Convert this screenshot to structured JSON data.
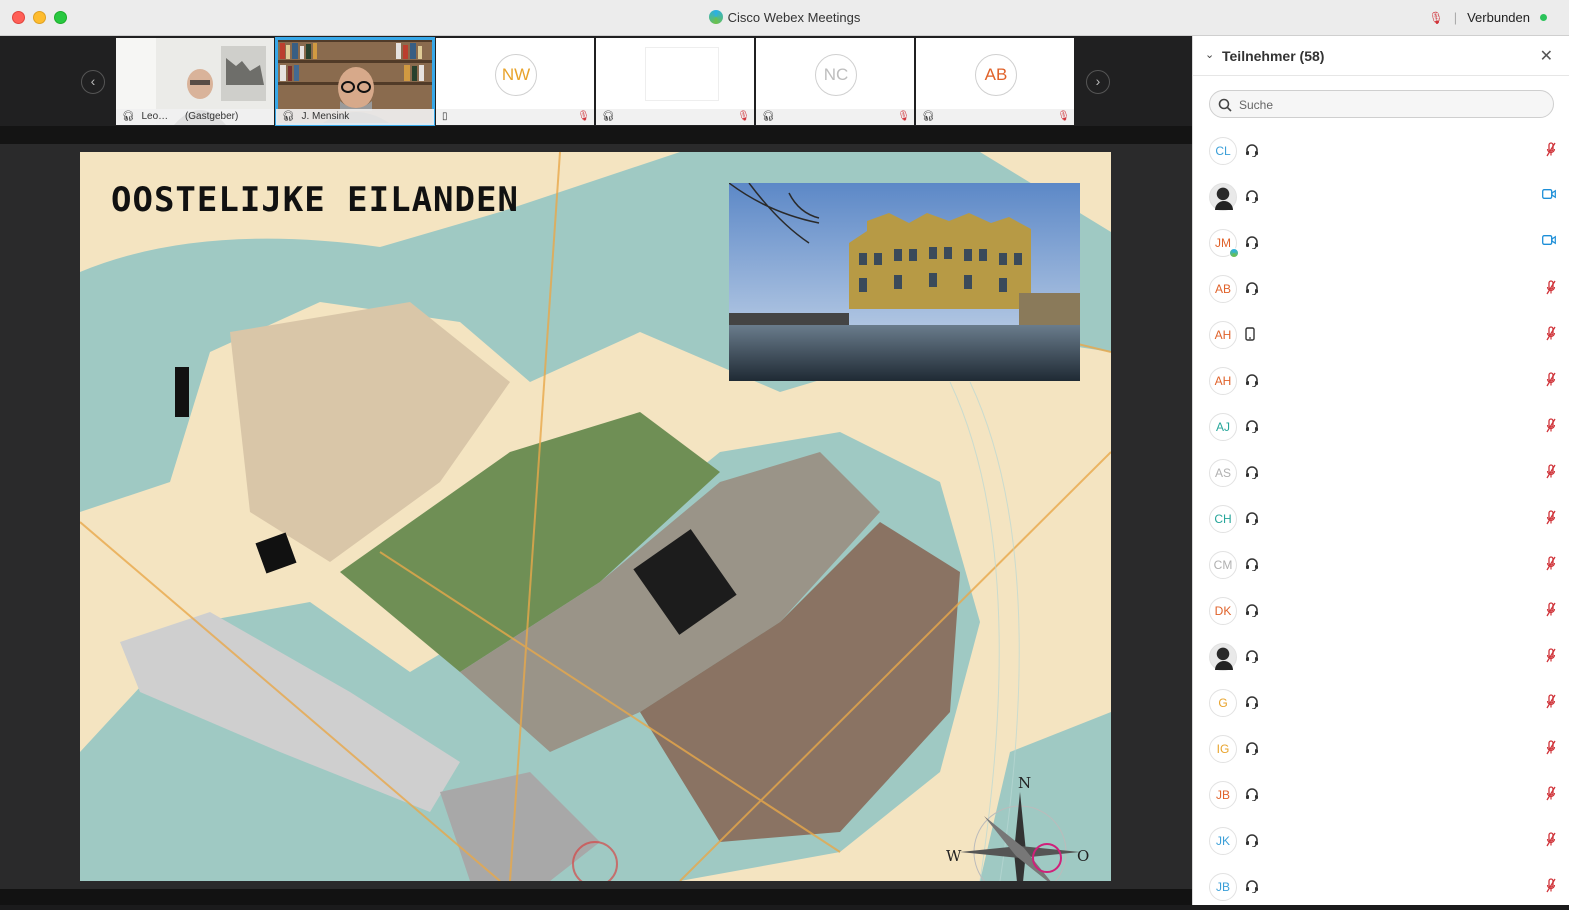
{
  "window": {
    "title": "Cisco Webex Meetings",
    "connection_status": "Verbunden"
  },
  "filmstrip": {
    "tiles": [
      {
        "name": "Leo…",
        "role": "(Gastgeber)",
        "type": "video"
      },
      {
        "name": "J. Mensink",
        "type": "video",
        "active": true
      },
      {
        "initials": "NW",
        "color": "#e8a32b",
        "type": "initials"
      },
      {
        "type": "blank"
      },
      {
        "initials": "NC",
        "color": "#bdbdbd",
        "type": "initials"
      },
      {
        "initials": "AB",
        "color": "#e0622a",
        "type": "initials"
      }
    ]
  },
  "slide": {
    "title": "OOSTELIJKE EILANDEN",
    "compass": {
      "n": "N",
      "w": "W",
      "o": "O"
    }
  },
  "panel": {
    "title": "Teilnehmer (58)",
    "search_placeholder": "Suche",
    "participants": [
      {
        "initials": "CL",
        "color": "#3b9fd8",
        "status": "muted"
      },
      {
        "initials": "",
        "avatar": "photo",
        "status": "video"
      },
      {
        "initials": "JM",
        "color": "#e0622a",
        "badge": true,
        "status": "video"
      },
      {
        "initials": "AB",
        "color": "#e0622a",
        "status": "muted"
      },
      {
        "initials": "AH",
        "color": "#e0622a",
        "device": "phone",
        "status": "muted"
      },
      {
        "initials": "AH",
        "color": "#e0622a",
        "status": "muted"
      },
      {
        "initials": "AJ",
        "color": "#26a69a",
        "status": "muted"
      },
      {
        "initials": "AS",
        "color": "#b0b0b0",
        "status": "muted"
      },
      {
        "initials": "CH",
        "color": "#26a69a",
        "status": "muted"
      },
      {
        "initials": "CM",
        "color": "#b0b0b0",
        "status": "muted"
      },
      {
        "initials": "DK",
        "color": "#e0622a",
        "status": "muted"
      },
      {
        "initials": "",
        "avatar": "photo",
        "status": "muted"
      },
      {
        "initials": "G",
        "color": "#e8a32b",
        "status": "muted"
      },
      {
        "initials": "IG",
        "color": "#e8a32b",
        "status": "muted"
      },
      {
        "initials": "JB",
        "color": "#e0622a",
        "status": "muted"
      },
      {
        "initials": "JK",
        "color": "#3b9fd8",
        "status": "muted"
      },
      {
        "initials": "JB",
        "color": "#3b9fd8",
        "status": "muted"
      }
    ]
  }
}
